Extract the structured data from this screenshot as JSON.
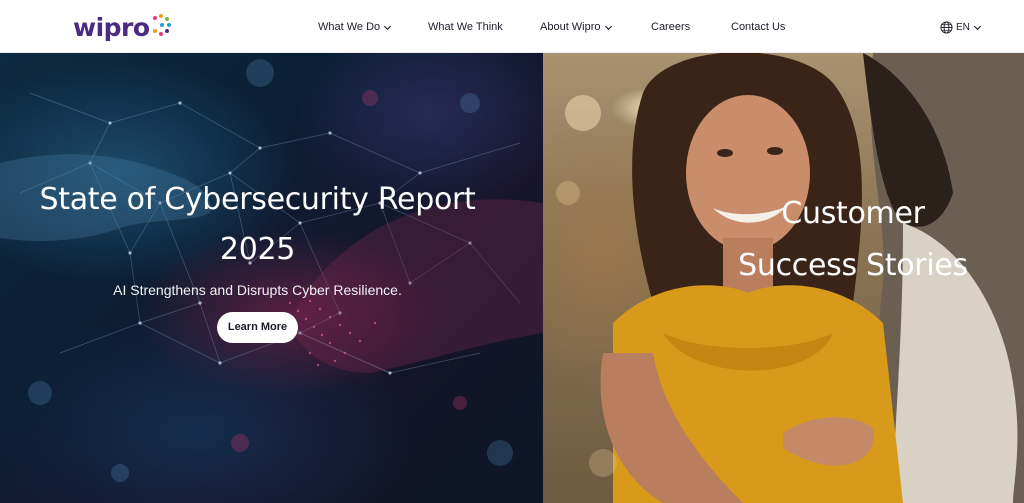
{
  "header": {
    "logo_text": "wipro",
    "nav": [
      {
        "label": "What We Do",
        "has_dropdown": true
      },
      {
        "label": "What We Think",
        "has_dropdown": false
      },
      {
        "label": "About Wipro",
        "has_dropdown": true
      },
      {
        "label": "Careers",
        "has_dropdown": false
      },
      {
        "label": "Contact Us",
        "has_dropdown": false
      }
    ],
    "language": {
      "label": "EN",
      "icon": "globe-icon"
    }
  },
  "hero_left": {
    "title_line1": "State of Cybersecurity Report",
    "title_line2": "2025",
    "subtitle": "AI Strengthens and Disrupts Cyber Resilience.",
    "cta": "Learn More"
  },
  "hero_right": {
    "title_line1": "Customer",
    "title_line2": "Success Stories"
  },
  "colors": {
    "brand": "#4b2a82",
    "nav_text": "#1e1e2d",
    "hero_text": "#ffffff"
  }
}
